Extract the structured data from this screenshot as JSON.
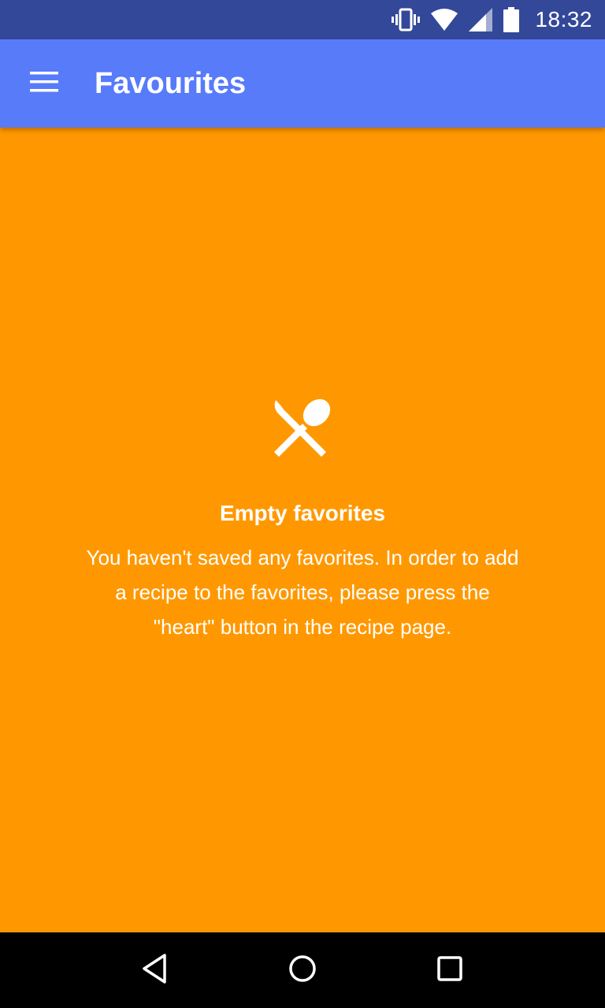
{
  "status_bar": {
    "time": "18:32",
    "icons": [
      "vibrate-icon",
      "wifi-icon",
      "signal-icon",
      "battery-icon"
    ]
  },
  "app_bar": {
    "title": "Favourites",
    "menu_icon": "menu-icon",
    "background_color": "#587bfa"
  },
  "empty_state": {
    "icon": "utensils-icon",
    "title": "Empty favorites",
    "message": "You haven't saved any favorites. In order to add a recipe to the favorites, please press the \"heart\" button in the recipe page.",
    "background_color": "#ff9800"
  },
  "nav_bar": {
    "buttons": [
      "back-icon",
      "home-icon",
      "recents-icon"
    ]
  }
}
